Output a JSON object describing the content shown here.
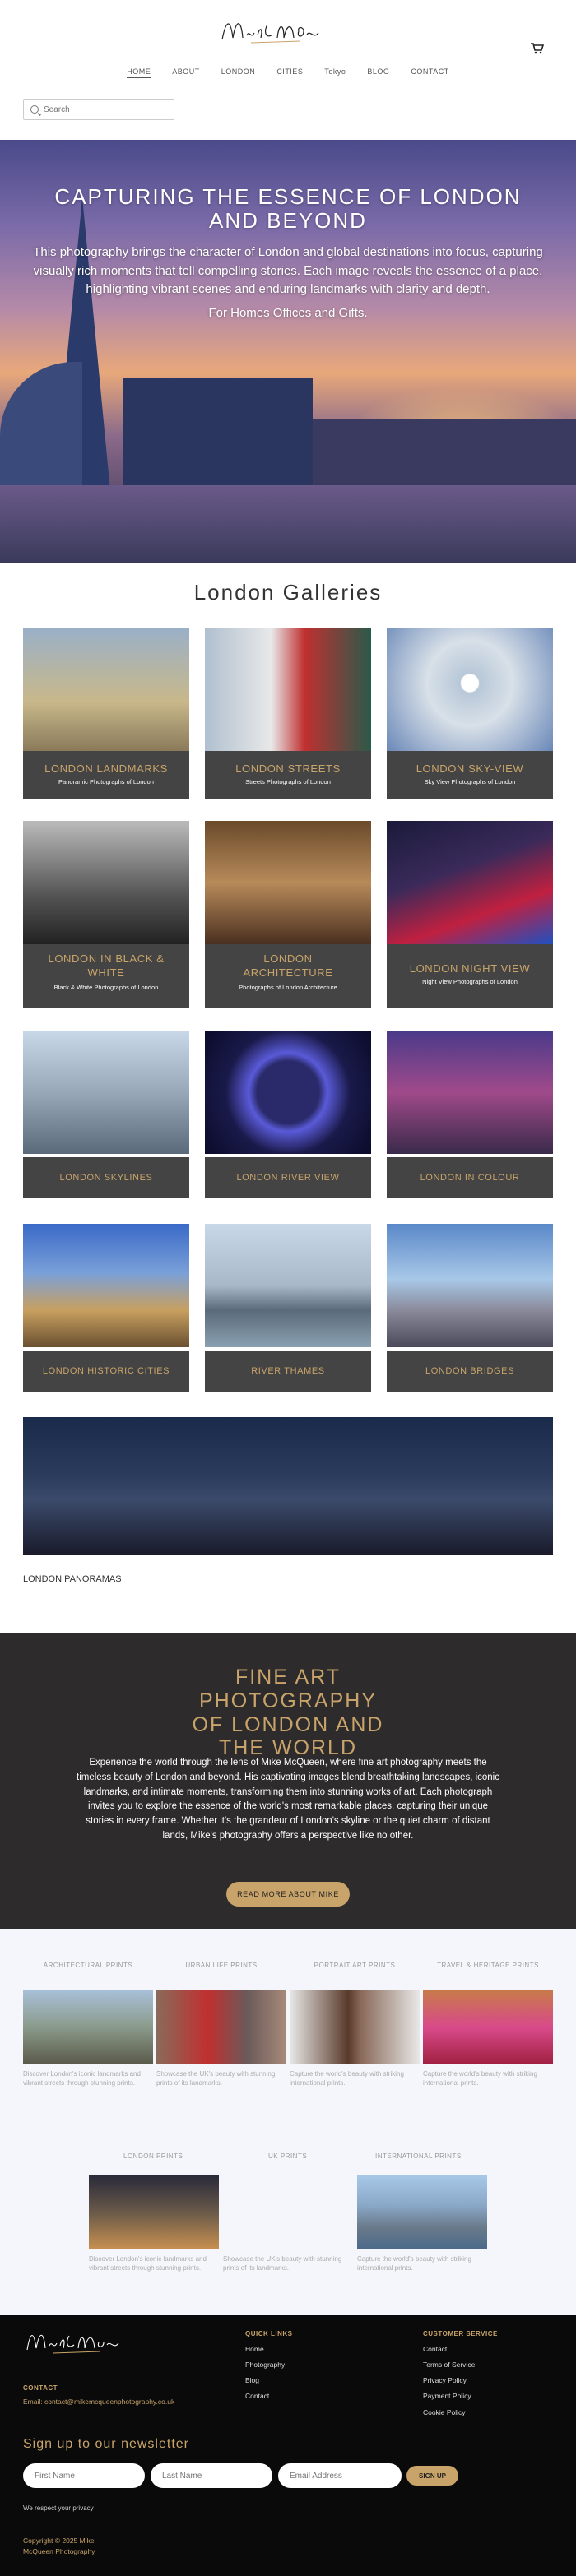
{
  "header": {
    "logo_text": "Mike McQueen",
    "nav": [
      "HOME",
      "ABOUT",
      "LONDON",
      "CITIES",
      "Tokyo",
      "BLOG",
      "CONTACT"
    ],
    "search_placeholder": "Search"
  },
  "hero": {
    "title": "CAPTURING THE ESSENCE OF LONDON AND BEYOND",
    "description": "This photography brings the character of London and global destinations into focus, capturing visually rich moments that tell compelling stories. Each image reveals the essence of a place, highlighting vibrant scenes and enduring landmarks with clarity and depth.",
    "subline": "For Homes Offices and Gifts."
  },
  "galleries": {
    "title": "London Galleries",
    "cards": [
      {
        "title": "LONDON LANDMARKS",
        "subtitle": "Panoramic Photographs of London"
      },
      {
        "title": "LONDON STREETS",
        "subtitle": "Streets Photographs of London"
      },
      {
        "title": "LONDON SKY-VIEW",
        "subtitle": "Sky View Photographs of London"
      },
      {
        "title": "LONDON IN BLACK & WHITE",
        "subtitle": "Black & White Photographs of London"
      },
      {
        "title": "LONDON ARCHITECTURE",
        "subtitle": "Photographs of London Architecture"
      },
      {
        "title": "LONDON NIGHT VIEW",
        "subtitle": "Night View  Photographs of London"
      },
      {
        "title": "LONDON SKYLINES",
        "subtitle": ""
      },
      {
        "title": "LONDON RIVER VIEW",
        "subtitle": ""
      },
      {
        "title": "LONDON IN COLOUR",
        "subtitle": ""
      },
      {
        "title": "LONDON HISTORIC CITIES",
        "subtitle": ""
      },
      {
        "title": "RIVER THAMES",
        "subtitle": ""
      },
      {
        "title": "LONDON BRIDGES",
        "subtitle": ""
      }
    ],
    "wide_card": {
      "title": "LONDON PANORAMAS"
    }
  },
  "fineart": {
    "title": "FINE ART PHOTOGRAPHY OF LONDON AND THE WORLD",
    "text": "Experience the world through the lens of Mike McQueen, where fine art photography meets the timeless beauty of London and beyond. His captivating images blend breathtaking landscapes, iconic landmarks, and intimate moments, transforming them into stunning works of art. Each photograph invites you to explore the essence of the world's most remarkable places, capturing their unique stories in every frame. Whether it's the grandeur of London's skyline or the quiet charm of distant lands, Mike's photography offers a perspective like no other.",
    "button": "READ MORE ABOUT MIKE"
  },
  "prints": {
    "row1": [
      {
        "label": "ARCHITECTURAL PRINTS",
        "desc": "Discover London's iconic landmarks and vibrant streets through stunning prints."
      },
      {
        "label": "URBAN LIFE PRINTS",
        "desc": "Showcase the UK's beauty with stunning prints of its landmarks."
      },
      {
        "label": "PORTRAIT ART PRINTS",
        "desc": "Capture the world's beauty with striking international prints."
      },
      {
        "label": "TRAVEL & HERITAGE PRINTS",
        "desc": "Capture the world's beauty with striking international prints."
      }
    ],
    "row2_labels": [
      "LONDON PRINTS",
      "UK PRINTS",
      "INTERNATIONAL PRINTS"
    ],
    "row2": [
      {
        "desc": "Discover London's iconic landmarks and vibrant streets through stunning prints."
      },
      {
        "desc": "Showcase the UK's beauty with stunning prints of its landmarks."
      },
      {
        "desc": "Capture the world's beauty with striking international prints."
      }
    ]
  },
  "footer": {
    "logo_text": "Mike McQueen",
    "quick_links_title": "QUICK LINKS",
    "quick_links": [
      "Home",
      "Photography",
      "Blog",
      "Contact"
    ],
    "customer_service_title": "CUSTOMER SERVICE",
    "customer_service": [
      "Contact",
      "Terms of Service",
      "Privacy Policy",
      "Payment Policy",
      "Cookie Policy"
    ],
    "contact_title": "CONTACT",
    "contact_email": "Email: contact@mikemcqueenphotography.co.uk",
    "newsletter_title": "Sign up to our newsletter",
    "first_name_placeholder": "First Name",
    "last_name_placeholder": "Last Name",
    "email_placeholder": "Email Address",
    "signup_button": "SIGN UP",
    "privacy_note": "We respect your privacy",
    "copyright": "Copyright © 2025 Mike McQueen Photography"
  }
}
